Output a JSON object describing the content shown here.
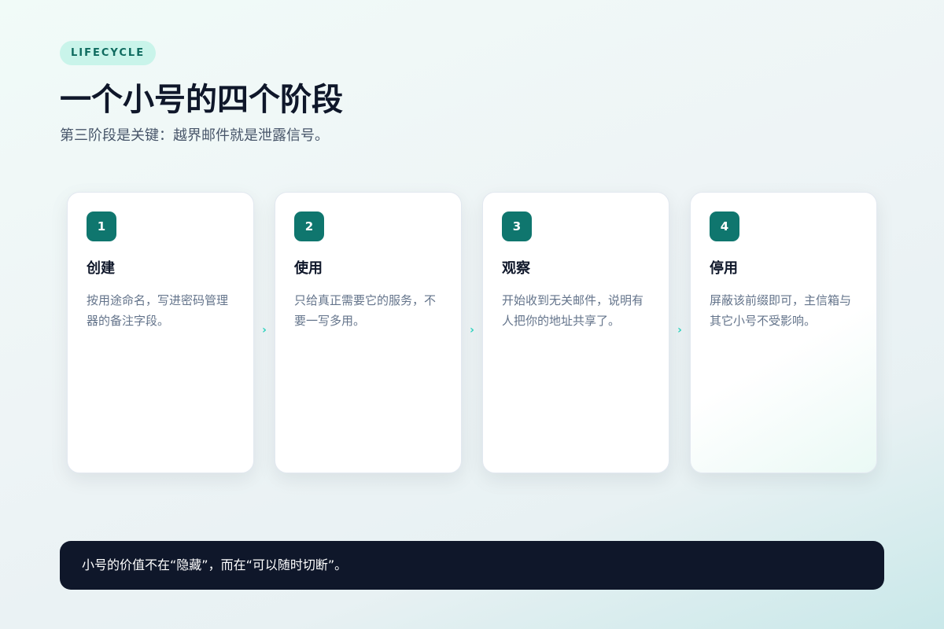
{
  "tag": "LIFECYCLE",
  "title": "一个小号的四个阶段",
  "subtitle": "第三阶段是关键：越界邮件就是泄露信号。",
  "stages": [
    {
      "number": "1",
      "title": "创建",
      "desc": "按用途命名，写进密码管理器的备注字段。"
    },
    {
      "number": "2",
      "title": "使用",
      "desc": "只给真正需要它的服务，不要一写多用。"
    },
    {
      "number": "3",
      "title": "观察",
      "desc": "开始收到无关邮件，说明有人把你的地址共享了。"
    },
    {
      "number": "4",
      "title": "停用",
      "desc": "屏蔽该前缀即可，主信箱与其它小号不受影响。"
    }
  ],
  "arrow_glyph": "›",
  "footer": "小号的价值不在“隐藏”，而在“可以随时切断”。",
  "colors": {
    "accent": "#0f766e",
    "tag_bg": "#c9f4ea",
    "arrow": "#2dd4bf",
    "footer_bg": "#0f172a"
  }
}
